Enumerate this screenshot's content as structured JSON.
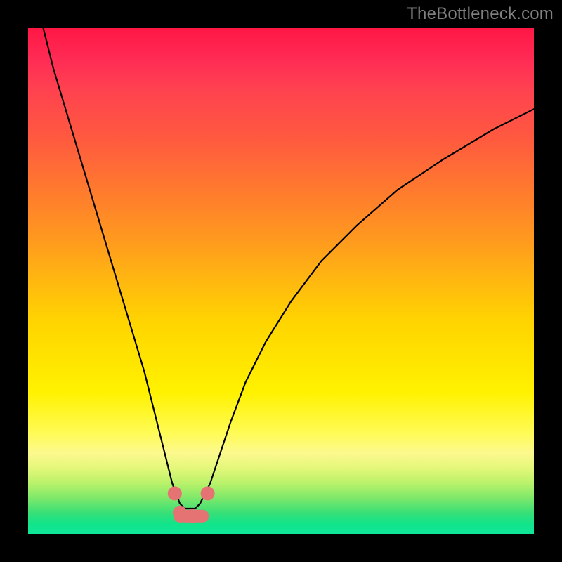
{
  "watermark": "TheBottleneck.com",
  "chart_data": {
    "type": "line",
    "title": "",
    "xlabel": "",
    "ylabel": "",
    "xlim": [
      0,
      100
    ],
    "ylim": [
      0,
      100
    ],
    "grid": false,
    "series": [
      {
        "name": "bottleneck-curve",
        "color": "#000000",
        "x": [
          3,
          5,
          8,
          11,
          14,
          17,
          20,
          23,
          25,
          27,
          28.5,
          30,
          31,
          32,
          33,
          34,
          36,
          38,
          40,
          43,
          47,
          52,
          58,
          65,
          73,
          82,
          92,
          100
        ],
        "values": [
          100,
          92,
          82,
          72,
          62,
          52,
          42,
          32,
          24,
          16,
          10,
          6,
          5,
          5,
          5,
          6,
          10,
          16,
          22,
          30,
          38,
          46,
          54,
          61,
          68,
          74,
          80,
          84
        ]
      }
    ],
    "markers": [
      {
        "name": "dot-left-upper",
        "x": 29,
        "y": 8,
        "color": "#e57373",
        "r": 10
      },
      {
        "name": "dot-left-lower",
        "x": 30,
        "y": 4.2,
        "color": "#e57373",
        "r": 10
      },
      {
        "name": "dot-mid",
        "x": 32.5,
        "y": 3.5,
        "color": "#e57373",
        "r": 10
      },
      {
        "name": "dot-right",
        "x": 35.5,
        "y": 8,
        "color": "#e57373",
        "r": 10
      }
    ],
    "marker_bar": {
      "x_from": 30,
      "x_to": 34.5,
      "y": 3.5,
      "color": "#e57373",
      "thickness": 18
    }
  }
}
